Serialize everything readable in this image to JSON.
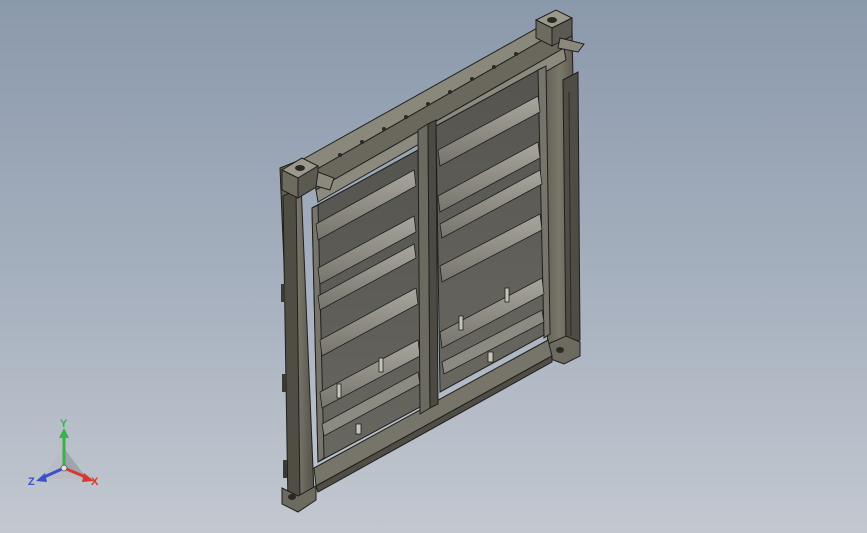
{
  "viewport": {
    "background_top": "#8b99ac",
    "background_bottom": "#c3c8d0"
  },
  "model": {
    "part_color": "#6f6c5c",
    "panel_color": "#5f5e57",
    "edge_color": "#1f1f1c"
  },
  "triad": {
    "x_label": "X",
    "y_label": "Y",
    "z_label": "Z",
    "x_color": "#d63a2f",
    "y_color": "#38b34a",
    "z_color": "#3a52c8"
  }
}
